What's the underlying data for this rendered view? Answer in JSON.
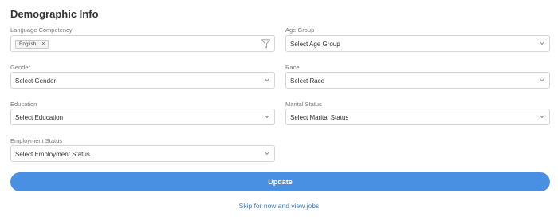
{
  "section_title": "Demographic Info",
  "fields": {
    "language": {
      "label": "Language Competency",
      "chip": "English",
      "chip_remove": "×"
    },
    "age_group": {
      "label": "Age Group",
      "value": "Select Age Group"
    },
    "gender": {
      "label": "Gender",
      "value": "Select Gender"
    },
    "race": {
      "label": "Race",
      "value": "Select Race"
    },
    "education": {
      "label": "Education",
      "value": "Select Education"
    },
    "marital_status": {
      "label": "Marital Status",
      "value": "Select Marital Status"
    },
    "employment_status": {
      "label": "Employment Status",
      "value": "Select Employment Status"
    }
  },
  "actions": {
    "update_label": "Update",
    "skip_label": "Skip for now and view jobs"
  },
  "colors": {
    "accent": "#4a90e2",
    "link": "#3a7cc8",
    "border": "#d6d6d6"
  },
  "icons": {
    "dropdown": "chevron-down-icon",
    "filter": "filter-icon",
    "remove": "close-icon"
  }
}
